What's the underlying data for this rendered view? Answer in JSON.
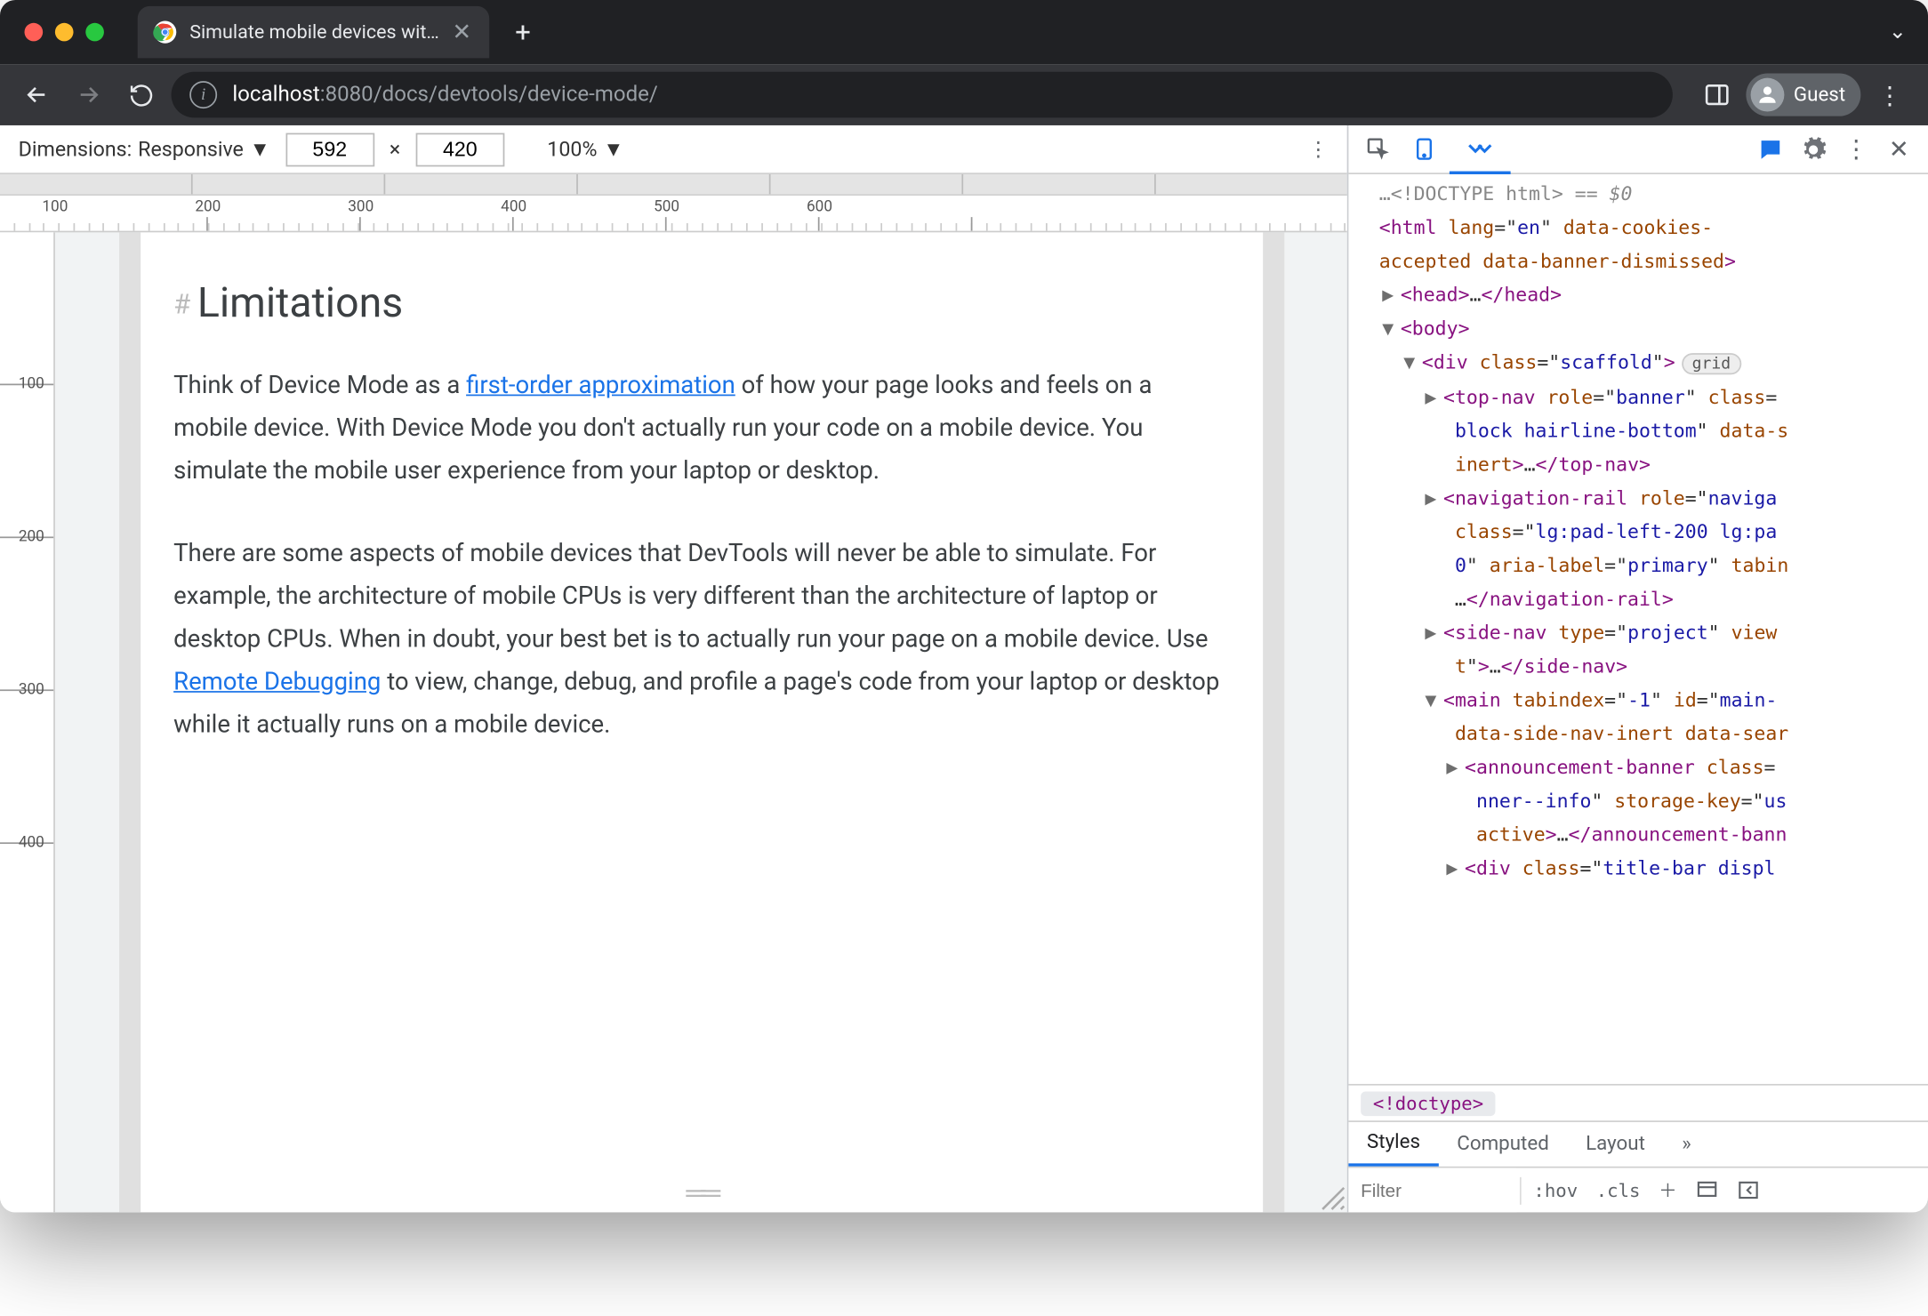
{
  "chrome": {
    "tab_title": "Simulate mobile devices with D",
    "url_host": "localhost",
    "url_port": ":8080",
    "url_path": "/docs/devtools/device-mode/",
    "guest_label": "Guest"
  },
  "devicebar": {
    "dimensions_label": "Dimensions:",
    "dimensions_value": "Responsive",
    "width": "592",
    "height": "420",
    "separator": "×",
    "zoom": "100%"
  },
  "ruler_h": [
    "100",
    "200",
    "300",
    "400",
    "500",
    "600"
  ],
  "ruler_v": [
    "100",
    "200",
    "300",
    "400"
  ],
  "page": {
    "heading": "Limitations",
    "p1_a": "Think of Device Mode as a ",
    "p1_link": "first-order approximation",
    "p1_b": " of how your page looks and feels on a mobile device. With Device Mode you don't actually run your code on a mobile device. You simulate the mobile user experience from your laptop or desktop.",
    "p2_a": "There are some aspects of mobile devices that DevTools will never be able to simulate. For example, the architecture of mobile CPUs is very different than the architecture of laptop or desktop CPUs. When in doubt, your best bet is to actually run your page on a mobile device. Use ",
    "p2_link": "Remote Debugging",
    "p2_b": " to view, change, debug, and profile a page's code from your laptop or desktop while it actually runs on a mobile device."
  },
  "devtools": {
    "doctype_line": "<!DOCTYPE html>",
    "eqdollar": " == $0",
    "crumb": "<!doctype>",
    "styles_tabs": [
      "Styles",
      "Computed",
      "Layout"
    ],
    "filter_placeholder": "Filter",
    "hov": ":hov",
    "cls": ".cls"
  },
  "dom_lines": [
    {
      "indent": 0,
      "arrow": "",
      "raw": "<span class='gray'>…</span><span class='gray'>&lt;!DOCTYPE html&gt;</span><span class='gray'> == </span><span class='gray' style='font-style:italic'>$0</span>"
    },
    {
      "indent": 0,
      "arrow": "",
      "raw": "<span class='punct'>&lt;</span><span class='tag'>html</span> <span class='attr'>lang</span>=\"<span class='val'>en</span>\" <span class='attr'>data-cookies-</span>"
    },
    {
      "indent": 0,
      "arrow": "",
      "raw": "<span class='attr'>accepted</span> <span class='attr'>data-banner-dismissed</span><span class='punct'>&gt;</span>"
    },
    {
      "indent": 1,
      "arrow": "▶",
      "raw": "<span class='punct'>&lt;</span><span class='tag'>head</span><span class='punct'>&gt;</span>…<span class='punct'>&lt;/</span><span class='tag'>head</span><span class='punct'>&gt;</span>"
    },
    {
      "indent": 1,
      "arrow": "▼",
      "raw": "<span class='punct'>&lt;</span><span class='tag'>body</span><span class='punct'>&gt;</span>"
    },
    {
      "indent": 2,
      "arrow": "▼",
      "raw": "<span class='punct'>&lt;</span><span class='tag'>div</span> <span class='attr'>class</span>=\"<span class='val'>scaffold</span>\"<span class='punct'>&gt;</span><span class='pill'>grid</span>"
    },
    {
      "indent": 3,
      "arrow": "▶",
      "raw": "<span class='punct'>&lt;</span><span class='tag'>top-nav</span> <span class='attr'>role</span>=\"<span class='val'>banner</span>\" <span class='attr'>class</span>="
    },
    {
      "indent": 3,
      "arrow": "",
      "raw": "&nbsp;<span class='val'>block hairline-bottom</span>\" <span class='attr'>data-s</span>"
    },
    {
      "indent": 3,
      "arrow": "",
      "raw": "&nbsp;<span class='attr'>inert</span><span class='punct'>&gt;</span>…<span class='punct'>&lt;/</span><span class='tag'>top-nav</span><span class='punct'>&gt;</span>"
    },
    {
      "indent": 3,
      "arrow": "▶",
      "raw": "<span class='punct'>&lt;</span><span class='tag'>navigation-rail</span> <span class='attr'>role</span>=\"<span class='val'>naviga</span>"
    },
    {
      "indent": 3,
      "arrow": "",
      "raw": "&nbsp;<span class='attr'>class</span>=\"<span class='val'>lg:pad-left-200 lg:pa</span>"
    },
    {
      "indent": 3,
      "arrow": "",
      "raw": "&nbsp;<span class='val'>0</span>\" <span class='attr'>aria-label</span>=\"<span class='val'>primary</span>\" <span class='attr'>tabin</span>"
    },
    {
      "indent": 3,
      "arrow": "",
      "raw": "&nbsp;…<span class='punct'>&lt;/</span><span class='tag'>navigation-rail</span><span class='punct'>&gt;</span>"
    },
    {
      "indent": 3,
      "arrow": "▶",
      "raw": "<span class='punct'>&lt;</span><span class='tag'>side-nav</span> <span class='attr'>type</span>=\"<span class='val'>project</span>\" <span class='attr'>view</span>"
    },
    {
      "indent": 3,
      "arrow": "",
      "raw": "&nbsp;<span class='attr'>t</span>\"<span class='punct'>&gt;</span>…<span class='punct'>&lt;/</span><span class='tag'>side-nav</span><span class='punct'>&gt;</span>"
    },
    {
      "indent": 3,
      "arrow": "▼",
      "raw": "<span class='punct'>&lt;</span><span class='tag'>main</span> <span class='attr'>tabindex</span>=\"<span class='val'>-1</span>\" <span class='attr'>id</span>=\"<span class='val'>main-</span>"
    },
    {
      "indent": 3,
      "arrow": "",
      "raw": "&nbsp;<span class='attr'>data-side-nav-inert</span> <span class='attr'>data-sear</span>"
    },
    {
      "indent": 4,
      "arrow": "▶",
      "raw": "<span class='punct'>&lt;</span><span class='tag'>announcement-banner</span> <span class='attr'>class</span>="
    },
    {
      "indent": 4,
      "arrow": "",
      "raw": "&nbsp;<span class='val'>nner--info</span>\" <span class='attr'>storage-key</span>=\"<span class='val'>us</span>"
    },
    {
      "indent": 4,
      "arrow": "",
      "raw": "&nbsp;<span class='attr'>active</span><span class='punct'>&gt;</span>…<span class='punct'>&lt;/</span><span class='tag'>announcement-bann</span>"
    },
    {
      "indent": 4,
      "arrow": "▶",
      "raw": "<span class='punct'>&lt;</span><span class='tag'>div</span> <span class='attr'>class</span>=\"<span class='val'>title-bar displ</span>"
    }
  ]
}
